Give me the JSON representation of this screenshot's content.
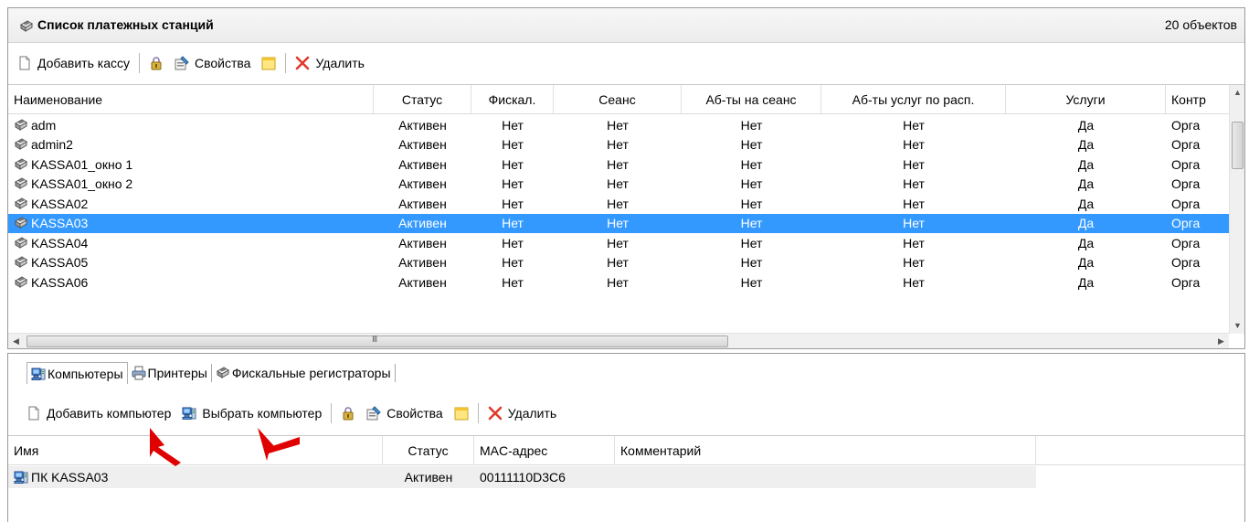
{
  "window": {
    "title": "Список платежных станций",
    "count": "20 объектов"
  },
  "top_toolbar": {
    "add_label": "Добавить кассу",
    "properties_label": "Свойства",
    "delete_label": "Удалить"
  },
  "stations_table": {
    "columns": [
      "Наименование",
      "Статус",
      "Фискал.",
      "Сеанс",
      "Аб-ты на сеанс",
      "Аб-ты услуг по расп.",
      "Услуги",
      "Контр"
    ],
    "rows": [
      {
        "name": "adm",
        "status": "Активен",
        "fiscal": "Нет",
        "session": "Нет",
        "ab_session": "Нет",
        "ab_services": "Нет",
        "services": "Да",
        "contr": "Орга"
      },
      {
        "name": "admin2",
        "status": "Активен",
        "fiscal": "Нет",
        "session": "Нет",
        "ab_session": "Нет",
        "ab_services": "Нет",
        "services": "Да",
        "contr": "Орга"
      },
      {
        "name": "KASSA01_окно 1",
        "status": "Активен",
        "fiscal": "Нет",
        "session": "Нет",
        "ab_session": "Нет",
        "ab_services": "Нет",
        "services": "Да",
        "contr": "Орга"
      },
      {
        "name": "KASSA01_окно 2",
        "status": "Активен",
        "fiscal": "Нет",
        "session": "Нет",
        "ab_session": "Нет",
        "ab_services": "Нет",
        "services": "Да",
        "contr": "Орга"
      },
      {
        "name": "KASSA02",
        "status": "Активен",
        "fiscal": "Нет",
        "session": "Нет",
        "ab_session": "Нет",
        "ab_services": "Нет",
        "services": "Да",
        "contr": "Орга"
      },
      {
        "name": "KASSA03",
        "status": "Активен",
        "fiscal": "Нет",
        "session": "Нет",
        "ab_session": "Нет",
        "ab_services": "Нет",
        "services": "Да",
        "contr": "Орга",
        "selected": true
      },
      {
        "name": "KASSA04",
        "status": "Активен",
        "fiscal": "Нет",
        "session": "Нет",
        "ab_session": "Нет",
        "ab_services": "Нет",
        "services": "Да",
        "contr": "Орга"
      },
      {
        "name": "KASSA05",
        "status": "Активен",
        "fiscal": "Нет",
        "session": "Нет",
        "ab_session": "Нет",
        "ab_services": "Нет",
        "services": "Да",
        "contr": "Орга"
      },
      {
        "name": "KASSA06",
        "status": "Активен",
        "fiscal": "Нет",
        "session": "Нет",
        "ab_session": "Нет",
        "ab_services": "Нет",
        "services": "Да",
        "contr": "Орга"
      }
    ]
  },
  "tabs": [
    "Компьютеры",
    "Принтеры",
    "Фискальные регистраторы"
  ],
  "bottom_toolbar": {
    "add_label": "Добавить компьютер",
    "choose_label": "Выбрать компьютер",
    "properties_label": "Свойства",
    "delete_label": "Удалить"
  },
  "computers_table": {
    "columns": [
      "Имя",
      "Статус",
      "MAC-адрес",
      "Комментарий"
    ],
    "rows": [
      {
        "name": "ПК KASSA03",
        "status": "Активен",
        "mac": "00111110D3C6",
        "comment": ""
      }
    ]
  },
  "colors": {
    "selection": "#3399ff",
    "annotation_arrow": "#e00000"
  },
  "icons": [
    "station-icon",
    "new-document-icon",
    "lock-icon",
    "properties-icon",
    "note-icon",
    "delete-x-icon",
    "computer-icon",
    "printer-icon"
  ]
}
